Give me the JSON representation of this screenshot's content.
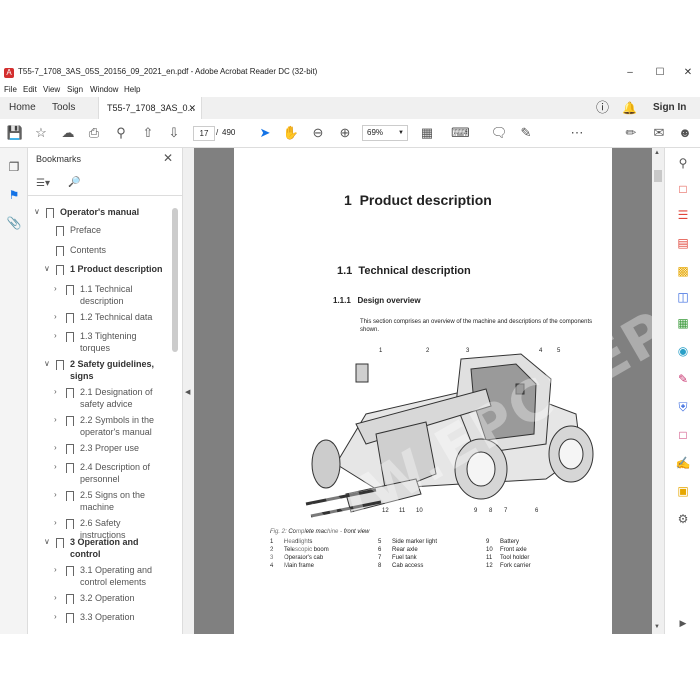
{
  "window": {
    "title": "T55-7_1708_3AS_05S_20156_09_2021_en.pdf - Adobe Acrobat Reader DC (32-bit)"
  },
  "menu": [
    "File",
    "Edit",
    "View",
    "Sign",
    "Window",
    "Help"
  ],
  "tabs": {
    "home": "Home",
    "tools": "Tools",
    "document": "T55-7_1708_3AS_0...",
    "sign_in": "Sign In"
  },
  "toolbar": {
    "current_page": "17",
    "page_sep": "/",
    "total_pages": "490",
    "zoom": "69%"
  },
  "bookmarks": {
    "header": "Bookmarks",
    "items": [
      {
        "label": "Operator's manual",
        "level": 0,
        "bold": true,
        "expanded": true
      },
      {
        "label": "Preface",
        "level": 1
      },
      {
        "label": "Contents",
        "level": 1
      },
      {
        "label": "1 Product description",
        "level": 1,
        "bold": true,
        "expanded": true
      },
      {
        "label": "1.1 Technical description",
        "level": 2
      },
      {
        "label": "1.2 Technical data",
        "level": 2
      },
      {
        "label": "1.3 Tightening torques",
        "level": 2
      },
      {
        "label": "2 Safety guidelines, signs",
        "level": 1,
        "bold": true,
        "expanded": true
      },
      {
        "label": "2.1 Designation of safety advice",
        "level": 2
      },
      {
        "label": "2.2 Symbols in the operator's manual",
        "level": 2
      },
      {
        "label": "2.3 Proper use",
        "level": 2
      },
      {
        "label": "2.4 Description of personnel",
        "level": 2
      },
      {
        "label": "2.5 Signs on the machine",
        "level": 2
      },
      {
        "label": "2.6 Safety instructions",
        "level": 2
      },
      {
        "label": "3 Operation and control",
        "level": 1,
        "bold": true,
        "expanded": true
      },
      {
        "label": "3.1 Operating and control elements",
        "level": 2
      },
      {
        "label": "3.2 Operation",
        "level": 2
      },
      {
        "label": "3.3 Operation",
        "level": 2
      }
    ]
  },
  "page": {
    "chapter": "1",
    "chapter_title": "Product description",
    "section": "1.1",
    "section_title": "Technical description",
    "subsection": "1.1.1",
    "subsection_title": "Design overview",
    "intro": "This section comprises an overview of the machine and descriptions of the components shown.",
    "figure_caption": "Fig. 2: Complete machine - front view",
    "callouts_top": [
      "1",
      "2",
      "3",
      "4",
      "5"
    ],
    "callouts_bottom": [
      "12",
      "11",
      "10",
      "9",
      "8",
      "7",
      "6"
    ],
    "legend": [
      {
        "n": "1",
        "t": "Headlights"
      },
      {
        "n": "5",
        "t": "Side marker light"
      },
      {
        "n": "9",
        "t": "Battery"
      },
      {
        "n": "2",
        "t": "Telescopic boom"
      },
      {
        "n": "6",
        "t": "Rear axle"
      },
      {
        "n": "10",
        "t": "Front axle"
      },
      {
        "n": "3",
        "t": "Operator's cab"
      },
      {
        "n": "7",
        "t": "Fuel tank"
      },
      {
        "n": "11",
        "t": "Tool holder"
      },
      {
        "n": "4",
        "t": "Main frame"
      },
      {
        "n": "8",
        "t": "Cab access"
      },
      {
        "n": "12",
        "t": "Fork carrier"
      }
    ]
  },
  "watermark": "WWW.EPCDEPO.COM",
  "colors": {
    "accent": "#1473e6",
    "pdf_red": "#d32f2f",
    "canvas": "#808080"
  }
}
